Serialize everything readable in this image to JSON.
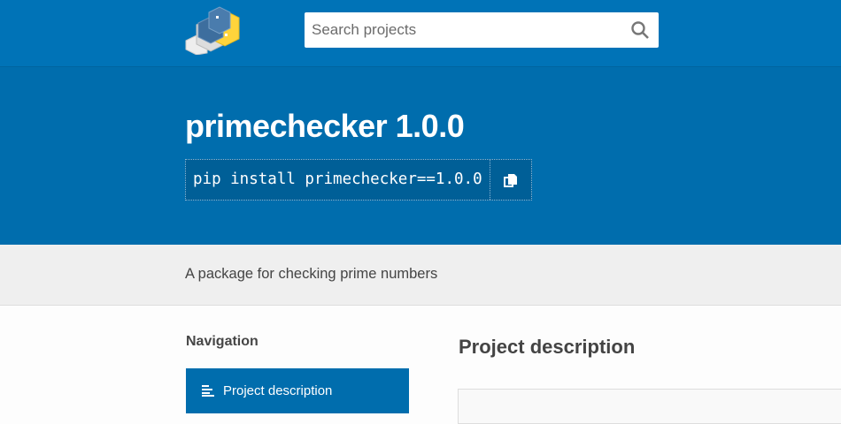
{
  "header": {
    "search_placeholder": "Search projects",
    "logo": "PyPI"
  },
  "package": {
    "title": "primechecker 1.0.0",
    "install_command": "pip install primechecker==1.0.0",
    "summary": "A package for checking prime numbers"
  },
  "sidebar": {
    "heading": "Navigation",
    "items": [
      {
        "label": "Project description",
        "icon": "list-icon",
        "active": true
      }
    ]
  },
  "main": {
    "heading": "Project description"
  },
  "colors": {
    "header": "#0073b7",
    "hero": "#006dad",
    "band": "#efefef"
  }
}
